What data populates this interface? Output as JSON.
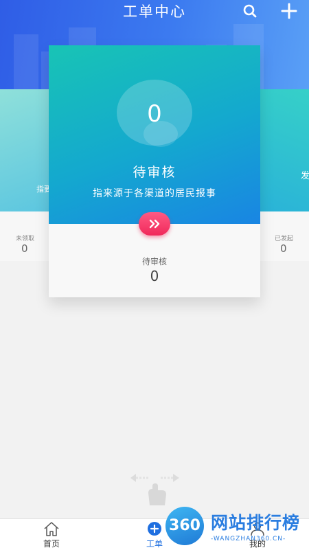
{
  "header": {
    "title": "工单中心",
    "icons": [
      "search-icon",
      "plus-icon"
    ]
  },
  "cards": {
    "left": {
      "text": "指要",
      "label": "未领取",
      "count": "0"
    },
    "center": {
      "count": "0",
      "title": "待审核",
      "description": "指来源于各渠道的居民报事",
      "action_icon": "double-chevron-right-icon",
      "label": "待审核",
      "bottom_count": "0"
    },
    "right": {
      "text": "发",
      "label": "已发起",
      "count": "0"
    }
  },
  "tabbar": {
    "items": [
      {
        "label": "首页",
        "icon": "home-icon"
      },
      {
        "label": "工单",
        "icon": "plus-circle-icon"
      },
      {
        "label": "我的",
        "icon": "user-icon"
      }
    ]
  },
  "watermark": {
    "badge": "360",
    "text": "网站排行榜",
    "url": "-WANGZHAN360.CN-"
  },
  "colors": {
    "header": "#3c7bf0",
    "card_teal": "#18c4b5",
    "card_blue": "#1985e3",
    "action_button": "#f0295b",
    "watermark": "#2a7de0"
  }
}
